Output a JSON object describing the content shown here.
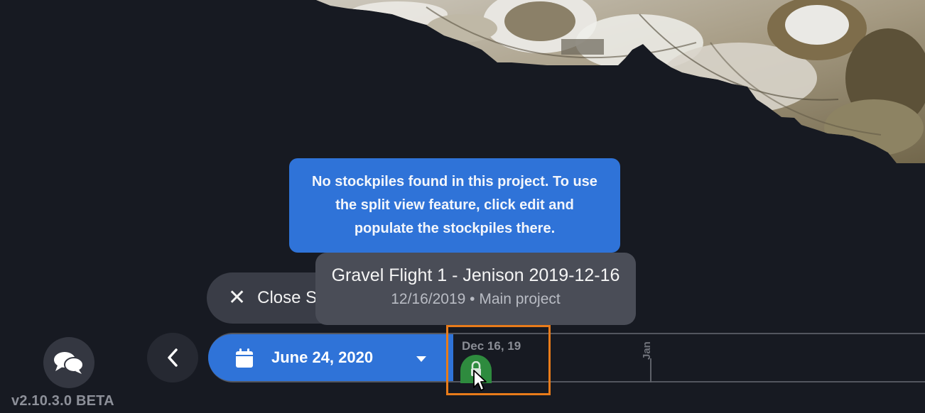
{
  "tooltip": {
    "message": "No stockpiles found in this project. To use the split view feature, click edit and populate the stockpiles there."
  },
  "close_split": {
    "label": "Close S"
  },
  "flight_card": {
    "title": "Gravel Flight 1 - Jenison 2019-12-16",
    "meta": "12/16/2019 • Main project"
  },
  "version": "v2.10.3.0 BETA",
  "date_picker": {
    "selected_date": "June 24, 2020"
  },
  "timeline": {
    "marker_date": "Dec 16, 19",
    "month_label": "Jan"
  },
  "colors": {
    "background": "#171a22",
    "accent_blue": "#2f73d8",
    "marker_green": "#2e8b3e",
    "highlight_orange": "#e87b1a"
  },
  "icons": [
    "chat-bubbles-icon",
    "chevron-left-icon",
    "calendar-icon",
    "caret-down-icon",
    "lock-icon",
    "close-icon",
    "mouse-cursor-icon"
  ]
}
